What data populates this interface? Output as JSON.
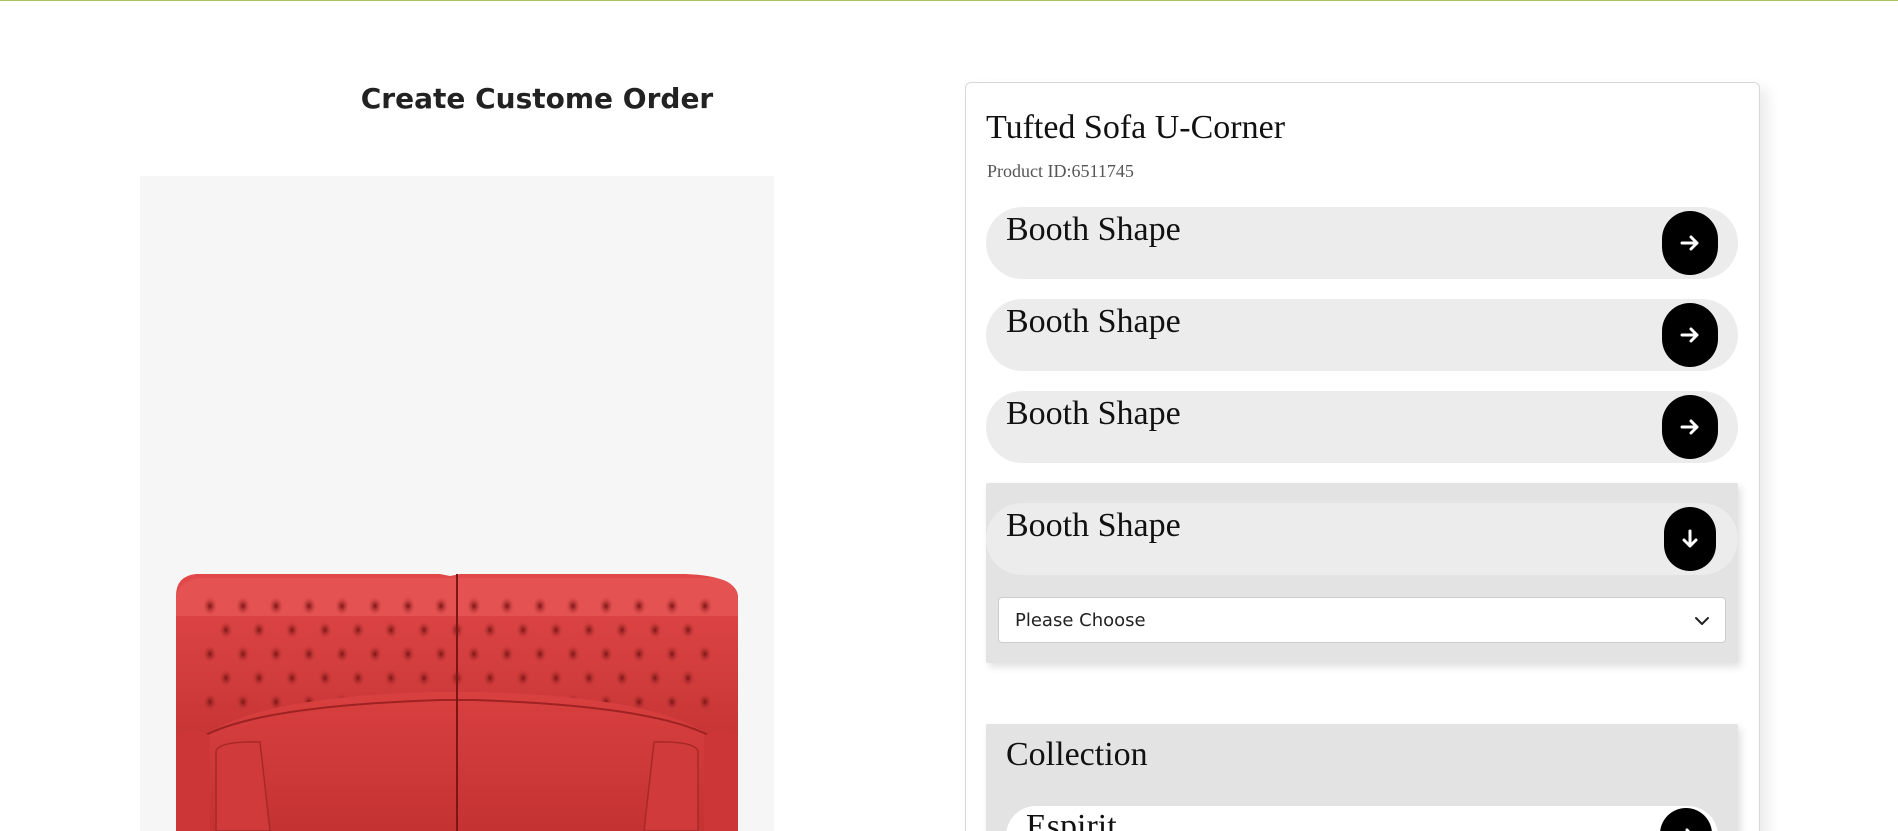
{
  "page": {
    "title": "Create Custome Order",
    "accent_color": "#a9c25a"
  },
  "product": {
    "image_alt": "red tufted sofa u-corner",
    "name": "Tufted Sofa U-Corner",
    "id_label": "Product ID:6511745",
    "sofa_color": "#d63a3a"
  },
  "options": [
    {
      "label": "Booth Shape",
      "icon": "arrow-right-icon"
    },
    {
      "label": "Booth Shape",
      "icon": "arrow-right-icon"
    },
    {
      "label": "Booth Shape",
      "icon": "arrow-right-icon"
    }
  ],
  "expanded_option": {
    "label": "Booth Shape",
    "icon": "arrow-down-icon",
    "select": {
      "selected": "Please Choose",
      "icon": "chevron-down-icon"
    }
  },
  "collection": {
    "title": "Collection",
    "items": [
      {
        "label": "Espirit",
        "icon": "arrow-right-icon"
      }
    ]
  }
}
